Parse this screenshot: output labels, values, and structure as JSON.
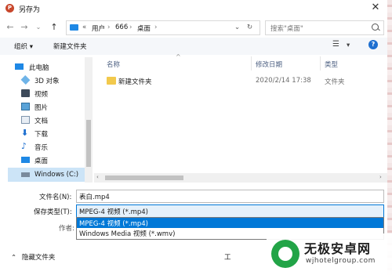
{
  "window": {
    "title": "另存为",
    "app_badge": "P"
  },
  "nav": {
    "path": [
      "用户",
      "666",
      "桌面"
    ],
    "path_prefix": "«",
    "search_placeholder": "搜索\"桌面\""
  },
  "toolbar": {
    "organize_label": "组织 ▾",
    "new_folder_label": "新建文件夹"
  },
  "sidebar": {
    "items": [
      {
        "label": "此电脑",
        "icon": "computer-icon"
      },
      {
        "label": "3D 对象",
        "icon": "3d-objects-icon"
      },
      {
        "label": "视频",
        "icon": "video-icon"
      },
      {
        "label": "图片",
        "icon": "pictures-icon"
      },
      {
        "label": "文档",
        "icon": "documents-icon"
      },
      {
        "label": "下载",
        "icon": "download-icon"
      },
      {
        "label": "音乐",
        "icon": "music-icon"
      },
      {
        "label": "桌面",
        "icon": "desktop-icon"
      },
      {
        "label": "Windows (C:)",
        "icon": "drive-icon"
      }
    ]
  },
  "columns": {
    "name": "名称",
    "modified": "修改日期",
    "type": "类型"
  },
  "files": [
    {
      "name": "新建文件夹",
      "modified": "2020/2/14 17:38",
      "type": "文件夹"
    }
  ],
  "form": {
    "filename_label": "文件名(N):",
    "filename_value": "表白.mp4",
    "type_label": "保存类型(T):",
    "type_value": "MPEG-4 视频 (*.mp4)",
    "type_options": [
      "MPEG-4 视频 (*.mp4)",
      "Windows Media 视频 (*.wmv)"
    ],
    "author_label": "作者:",
    "tools_label": "工"
  },
  "footer": {
    "hide_folders_label": "隐藏文件夹"
  },
  "watermark": {
    "title": "无极安卓网",
    "url": "wjhotelgroup.com"
  },
  "colors": {
    "accent": "#0078d7",
    "selection": "#cce4f7",
    "watermark_green": "#22a447"
  }
}
